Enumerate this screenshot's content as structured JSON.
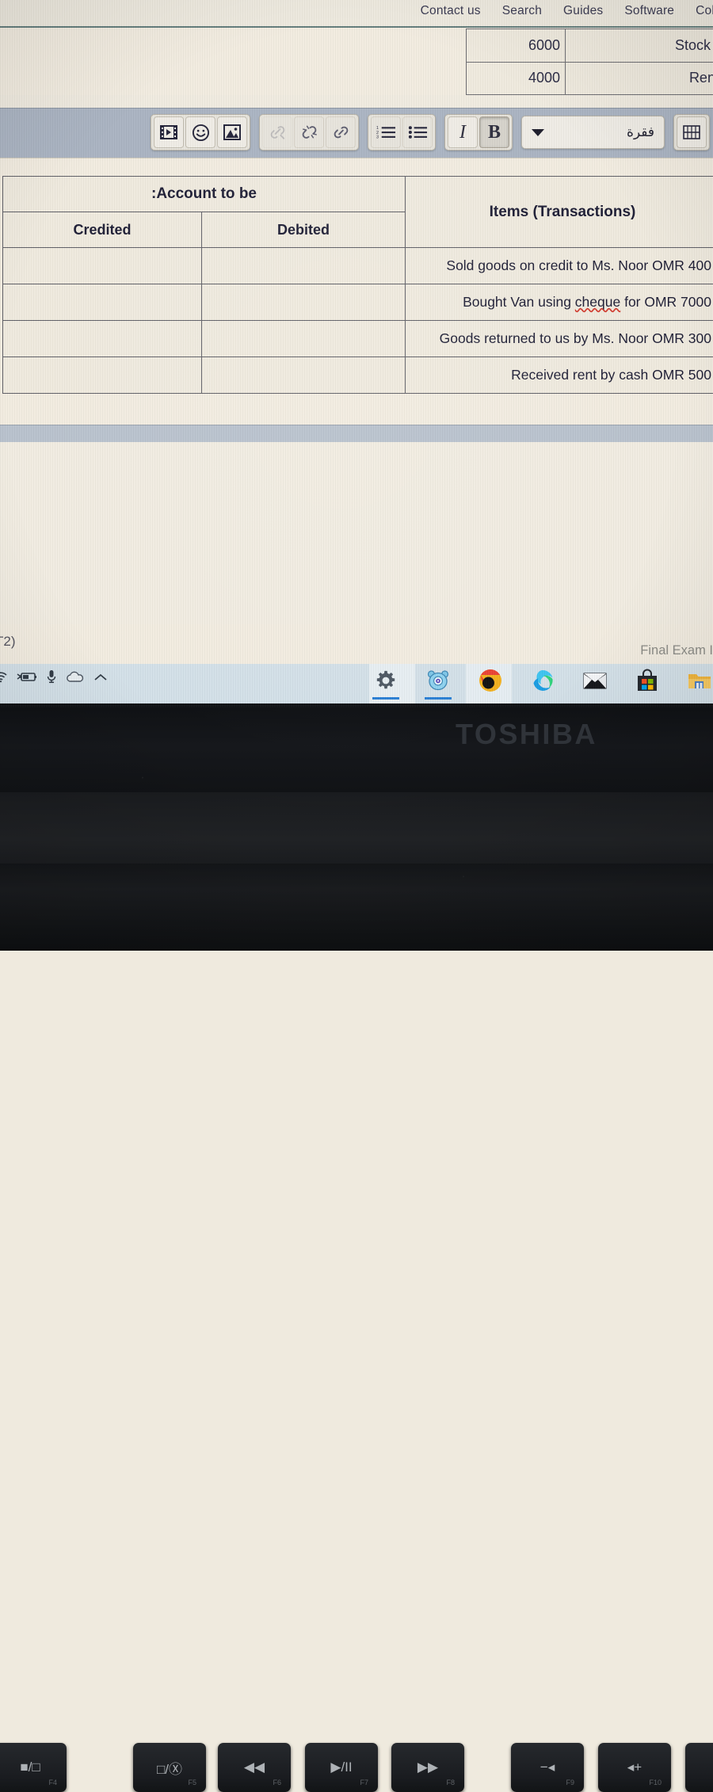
{
  "site_nav": {
    "items": [
      {
        "label": "Contact us"
      },
      {
        "label": "Search"
      },
      {
        "label": "Guides"
      },
      {
        "label": "Software"
      },
      {
        "label": "Col"
      }
    ]
  },
  "top_table": {
    "rows": [
      {
        "amount": "6000",
        "label": "Stock (inventory"
      },
      {
        "amount": "4000",
        "label": "Rent received"
      }
    ]
  },
  "toolbar": {
    "buttons": [
      {
        "name": "insert-video-button",
        "icon": "film-icon",
        "state": "normal"
      },
      {
        "name": "insert-emoji-button",
        "icon": "smiley-icon",
        "state": "normal"
      },
      {
        "name": "insert-image-button",
        "icon": "image-icon",
        "state": "normal"
      },
      {
        "name": "edit-link-button",
        "icon": "link-edit-icon",
        "state": "disabled"
      },
      {
        "name": "unlink-button",
        "icon": "broken-link-icon",
        "state": "normal"
      },
      {
        "name": "insert-link-button",
        "icon": "link-icon",
        "state": "normal"
      },
      {
        "name": "numbered-list-button",
        "icon": "numbered-list-icon",
        "state": "normal"
      },
      {
        "name": "bullet-list-button",
        "icon": "bullet-list-icon",
        "state": "normal"
      },
      {
        "name": "italic-button",
        "icon": "italic-icon",
        "label": "I",
        "state": "normal"
      },
      {
        "name": "bold-button",
        "icon": "bold-icon",
        "label": "B",
        "state": "active"
      },
      {
        "name": "insert-table-button",
        "icon": "table-grid-icon",
        "state": "normal"
      }
    ],
    "paragraph_select": {
      "value": "فقرة",
      "name": "paragraph-style-select"
    }
  },
  "doc_table": {
    "header_span": ":Account to be",
    "header_credited": "Credited",
    "header_debited": "Debited",
    "header_items": "Items (Transactions)",
    "rows": [
      {
        "credited": "",
        "debited": "",
        "item_pre": "Sold goods on credit to Ms. Noor OMR 400",
        "item_mis": "",
        "item_post": ""
      },
      {
        "credited": "",
        "debited": "",
        "item_pre": "Bought Van using ",
        "item_mis": "cheque",
        "item_post": " for OMR 7000"
      },
      {
        "credited": "",
        "debited": "",
        "item_pre": "Goods returned to us by Ms. Noor OMR 300",
        "item_mis": "",
        "item_post": ""
      },
      {
        "credited": "",
        "debited": "",
        "item_pre": "Received rent by cash OMR 500",
        "item_mis": "",
        "item_post": ""
      }
    ]
  },
  "page_footer": {
    "left_cut_text": "T2)",
    "exam_text": "Final Exam I"
  },
  "taskbar": {
    "tray_icons": [
      {
        "name": "wifi-icon"
      },
      {
        "name": "battery-charging-icon"
      },
      {
        "name": "microphone-icon"
      },
      {
        "name": "onedrive-cloud-icon"
      },
      {
        "name": "show-hidden-icons-chevron-icon"
      }
    ],
    "app_icons": [
      {
        "name": "settings-gear-icon"
      },
      {
        "name": "blue-assistant-app-icon"
      },
      {
        "name": "google-chrome-icon"
      },
      {
        "name": "microsoft-edge-icon"
      },
      {
        "name": "mail-icon"
      },
      {
        "name": "microsoft-store-icon"
      },
      {
        "name": "file-explorer-icon"
      }
    ]
  },
  "laptop": {
    "brand": "TOSHIBA",
    "function_keys": [
      {
        "name": "display-toggle-key",
        "glyph": "■/□",
        "fn": "F4"
      },
      {
        "name": "touchpad-toggle-key",
        "glyph": "□/Ⓧ",
        "fn": "F5"
      },
      {
        "name": "previous-track-key",
        "glyph": "◀◀",
        "fn": "F6"
      },
      {
        "name": "play-pause-key",
        "glyph": "▶/II",
        "fn": "F7"
      },
      {
        "name": "next-track-key",
        "glyph": "▶▶",
        "fn": "F8"
      },
      {
        "name": "volume-down-key",
        "glyph": "−◂",
        "fn": "F9"
      },
      {
        "name": "volume-up-key",
        "glyph": "◂+",
        "fn": "F10"
      }
    ]
  },
  "colors": {
    "toolbar_band": "#aab4c2",
    "taskbar": "#d3e0e8",
    "paper": "#efeade",
    "nav_rule": "#4a6a6a",
    "spellcheck_underline": "#d23b2e"
  }
}
